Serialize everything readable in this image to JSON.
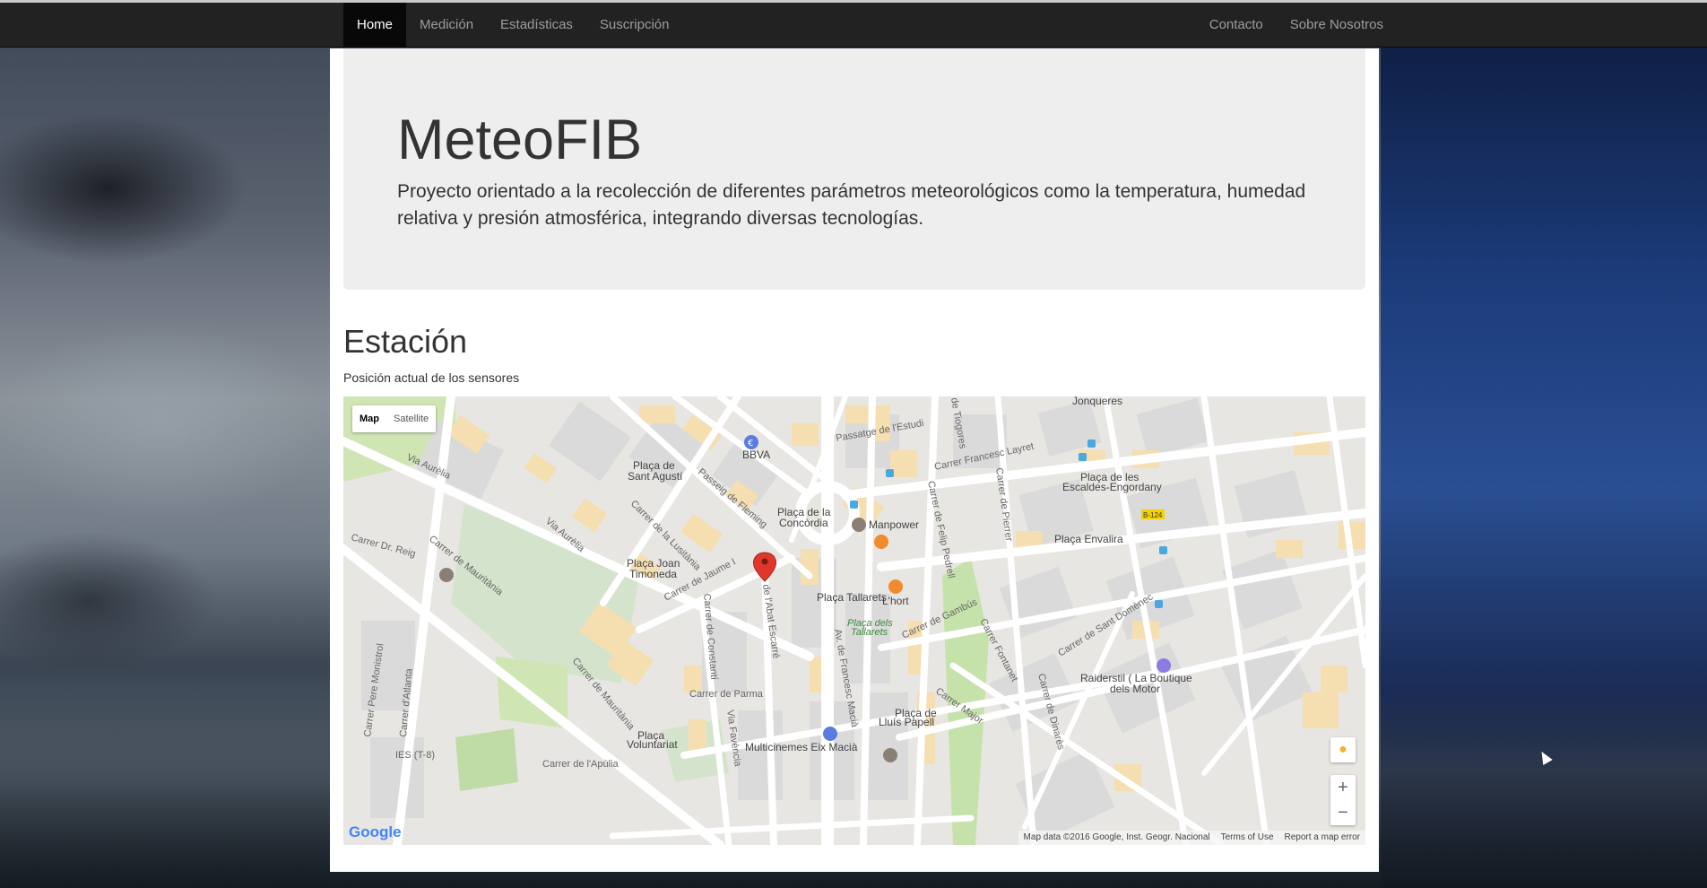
{
  "navbar": {
    "left_items": [
      {
        "label": "Home",
        "active": true
      },
      {
        "label": "Medición",
        "active": false
      },
      {
        "label": "Estadísticas",
        "active": false
      },
      {
        "label": "Suscripción",
        "active": false
      }
    ],
    "right_items": [
      {
        "label": "Contacto"
      },
      {
        "label": "Sobre Nosotros"
      }
    ]
  },
  "jumbotron": {
    "title": "MeteoFIB",
    "text": "Proyecto orientado a la recolección de diferentes parámetros meteorológicos como la temperatura, humedad relativa y presión atmosférica, integrando diversas tecnologías."
  },
  "station": {
    "title": "Estación",
    "subtitle": "Posición actual de los sensores"
  },
  "map": {
    "type_buttons": {
      "map": "Map",
      "satellite": "Satellite"
    },
    "zoom_in": "+",
    "zoom_out": "−",
    "google_logo": "Google",
    "attribution": {
      "data": "Map data ©2016 Google, Inst. Geogr. Nacional",
      "terms": "Terms of Use",
      "report": "Report a map error"
    },
    "labels": {
      "bbva": "BBVA",
      "placa_sant_agusti_1": "Plaça de",
      "placa_sant_agusti_2": "Sant Agustí",
      "placa_concordia_1": "Plaça de la",
      "placa_concordia_2": "Concòrdia",
      "manpower": "Manpower",
      "placa_joan_1": "Plaça Joan",
      "placa_joan_2": "Timoneda",
      "placa_tallarets": "Plaça Tallarets",
      "lhort": "L'hort",
      "placa_dels_1": "Plaça dels",
      "placa_dels_2": "Tallarets",
      "jonqueres": "Jonqueres",
      "placa_escaldes_1": "Plaça de les",
      "placa_escaldes_2": "Escaldes-Engordany",
      "placa_envalira": "Plaça Envalira",
      "b124": "B-124",
      "raiderstil_1": "Raiderstil ( La Boutique",
      "raiderstil_2": "dels Motor",
      "placa_lluis_1": "Plaça de",
      "placa_lluis_2": "Lluís Papell",
      "multicinemes": "Multicinemes Eix Macià",
      "placa_voluntariat_1": "Plaça",
      "placa_voluntariat_2": "Voluntariat",
      "ies": "IES (T-8)",
      "carrer_parma": "Carrer de Parma",
      "carrer_apulia": "Carrer de l'Apúlia",
      "via_aurelia": "Via Aurèlia",
      "carrer_mauritania": "Carrer de Mauritània",
      "carrer_jaume": "Carrer de Jaume I",
      "av_macia": "Av. de Francesc Macià",
      "carrer_layret": "Carrer Francesc Layret",
      "carrer_gambus": "Carrer de Gambús",
      "carrer_major": "Carrer Major",
      "carrer_dr_reig": "Carrer Dr. Reig",
      "carrer_sant_domenec": "Carrer de Sant Domènec",
      "passeig_fleming": "Passeig de Fleming",
      "carrer_lusitania": "Carrer de la Lusitània",
      "abat_escarre": "de l'Abat Escarré",
      "carrer_constanti": "Carrer de Constantí",
      "passatge_estudi": "Passatge de l'Estudi",
      "carrer_pere_monistrol": "Carrer Pere Monistrol",
      "carrer_atlanta": "Carrer d'Atlanta",
      "carrer_fontanet": "Carrer Fontanet",
      "carrer_dinares": "Carrer de Dinarès",
      "carrer_pierrer": "Carrer de Pierrer",
      "carrer_pedrell": "Carrer de Felip Pedrell",
      "de_tiogores": "de Tiogores",
      "carrer_favencia": "Via Favència"
    }
  }
}
